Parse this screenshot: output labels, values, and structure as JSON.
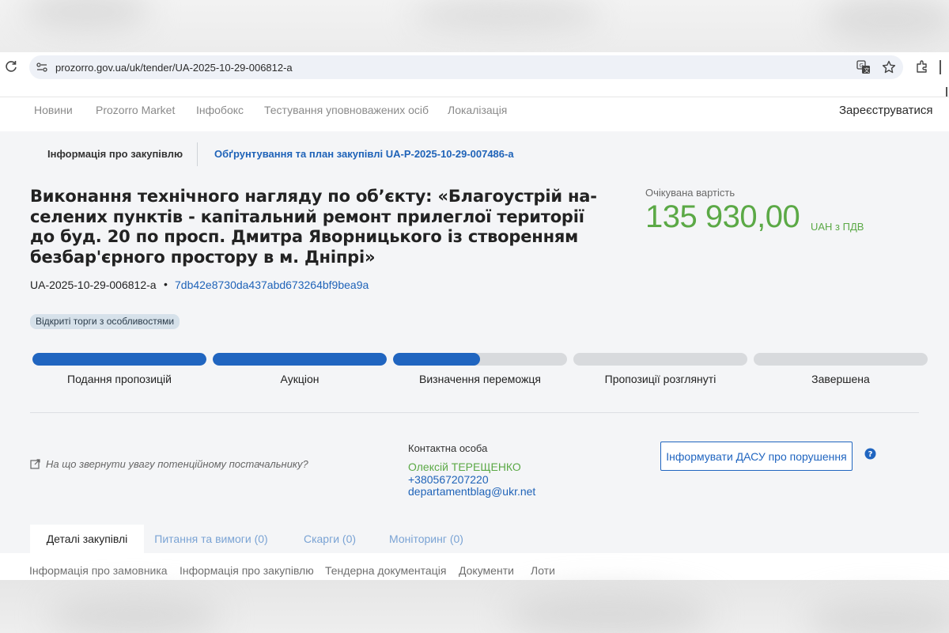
{
  "browser": {
    "url": "prozorro.gov.ua/uk/tender/UA-2025-10-29-006812-a"
  },
  "site_nav": {
    "items": [
      "Новини",
      "Prozorro Market",
      "Інфобокс",
      "Тестування уповноважених осіб",
      "Локалізація"
    ],
    "register": "Зареєструватися"
  },
  "info_tabs": {
    "active": "Інформація про закупівлю",
    "link": "Обґрунтування та план закупівлі UA-P-2025-10-29-007486-a"
  },
  "tender": {
    "title_lines": [
      "Виконання технічного нагляду по об’єкту: «Благоустрій на-",
      "селених пунктів - капітальний ремонт прилеглої території",
      "до буд. 20 по просп. Дмитра Яворницького із створенням",
      "безбар'єрного простору в м. Дніпрі»"
    ],
    "id": "UA-2025-10-29-006812-a",
    "separator": "•",
    "hash": "7db42e8730da437abd673264bf9bea9a",
    "procedure": "Відкриті торги з особливостями"
  },
  "expected_value": {
    "label": "Очікувана вартість",
    "amount": "135 930,00",
    "currency": "UAH з ПДВ"
  },
  "stages": [
    {
      "label": "Подання пропозицій",
      "progress": 1.0
    },
    {
      "label": "Аукціон",
      "progress": 1.0
    },
    {
      "label": "Визначення переможця",
      "progress": 0.5
    },
    {
      "label": "Пропозиції розглянуті",
      "progress": 0
    },
    {
      "label": "Завершена",
      "progress": 0
    }
  ],
  "supplier_hint": "На що звернути увагу потенційному постачальнику?",
  "contact": {
    "label": "Контактна особа",
    "name": "Олексій ТЕРЕЩЕНКО",
    "phone": "+380567207220",
    "email": "departamentblag@ukr.net"
  },
  "dasu_button": "Інформувати ДАСУ про порушення",
  "detail_tabs": [
    {
      "label": "Деталі закупівлі",
      "active": true
    },
    {
      "label": "Питання та вимоги (0)",
      "active": false
    },
    {
      "label": "Скарги (0)",
      "active": false
    },
    {
      "label": "Моніторинг (0)",
      "active": false
    }
  ],
  "section_links": [
    "Інформація про замовника",
    "Інформація про закупівлю",
    "Тендерна документація",
    "Документи",
    "Лоти"
  ],
  "colors": {
    "accent_blue": "#2065c0",
    "amount_green": "#5ba946",
    "badge_bg": "#d6e1ea"
  },
  "icons": [
    "reload-icon",
    "site-info-icon",
    "translate-icon",
    "star-icon",
    "extensions-icon",
    "external-link-icon",
    "help-icon"
  ]
}
